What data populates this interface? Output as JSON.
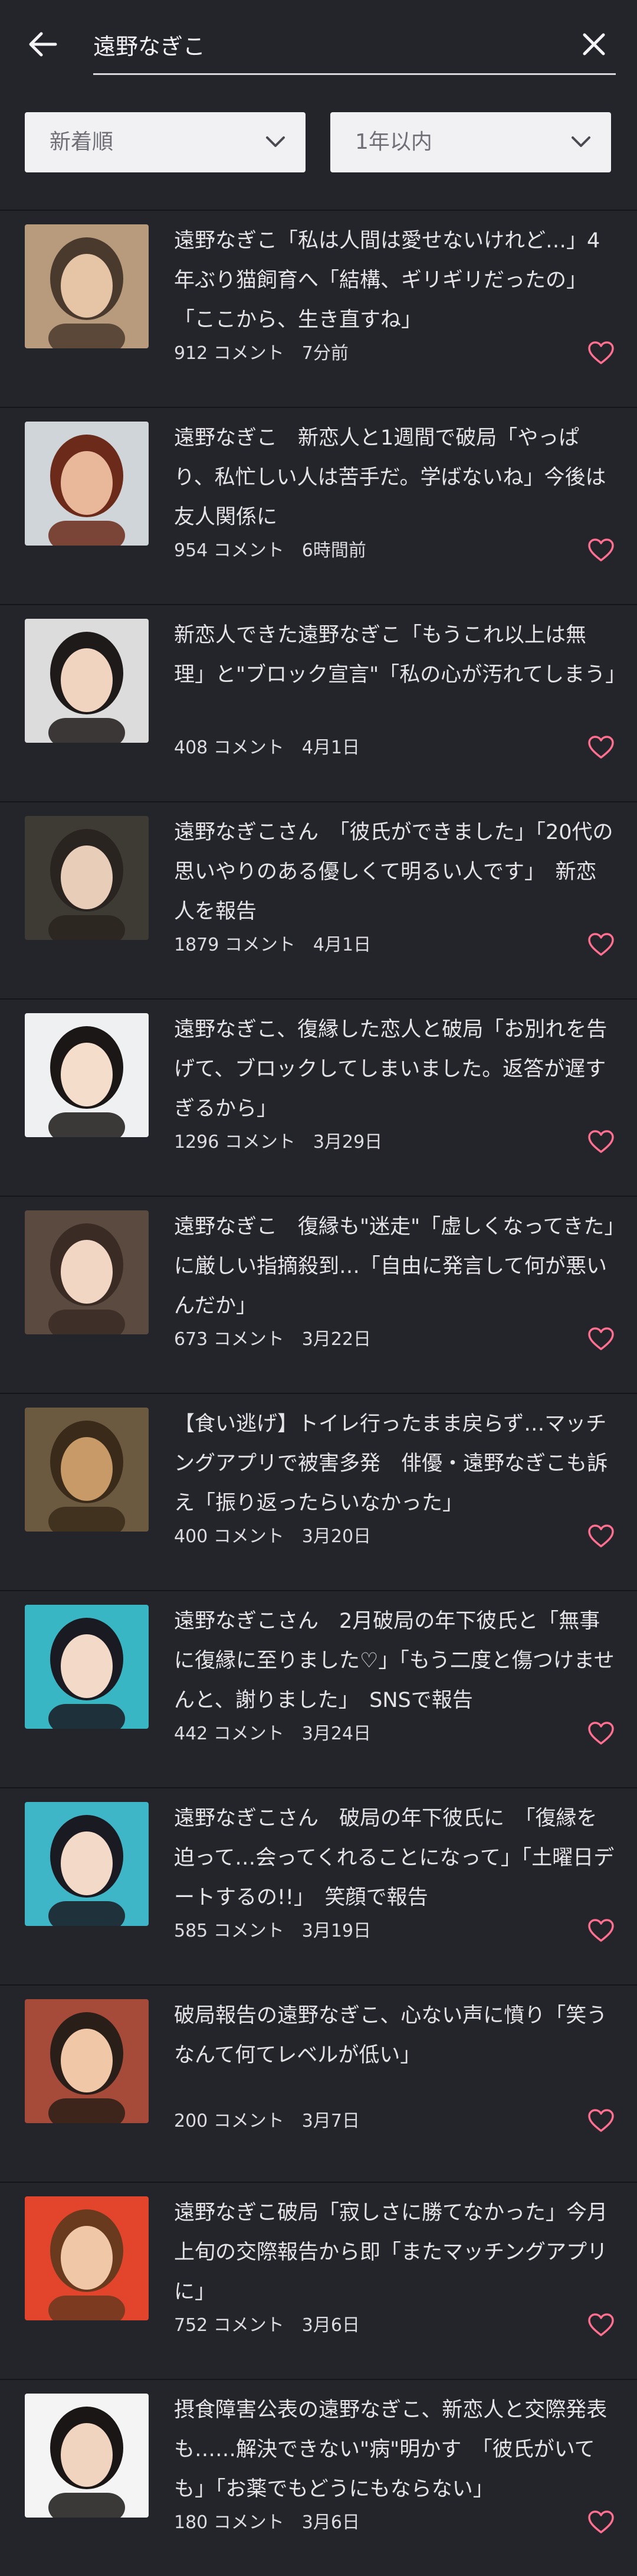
{
  "header": {
    "back_icon": "arrow-left-icon",
    "search_value": "遠野なぎこ",
    "clear_icon": "close-icon"
  },
  "filters": {
    "sort_selected": "新着順",
    "period_selected": "1年以内"
  },
  "colors": {
    "background": "#24242b",
    "heart": "#ff6f8f",
    "select_bg": "#f1f1f4"
  },
  "articles": [
    {
      "title": "遠野なぎこ「私は人間は愛せないけれど…」4年ぶり猫飼育へ「結構、ギリギリだったの」「ここから、生き直すね」",
      "comments": "912 コメント",
      "time": "7分前",
      "lines": 3
    },
    {
      "title": "遠野なぎこ　新恋人と1週間で破局「やっぱり、私忙しい人は苦手だ。学ばないね」今後は友人関係に",
      "comments": "954 コメント",
      "time": "6時間前",
      "lines": 3
    },
    {
      "title": "新恋人できた遠野なぎこ「もうこれ以上は無理」と\"ブロック宣言\"「私の心が汚れてしまう」",
      "comments": "408 コメント",
      "time": "4月1日",
      "lines": 3
    },
    {
      "title": "遠野なぎこさん　「彼氏ができました」「20代の思いやりのある優しくて明るい人です」　新恋人を報告",
      "comments": "1879 コメント",
      "time": "4月1日",
      "lines": 3
    },
    {
      "title": "遠野なぎこ、復縁した恋人と破局「お別れを告げて、ブロックしてしまいました。返答が遅すぎるから」",
      "comments": "1296 コメント",
      "time": "3月29日",
      "lines": 3
    },
    {
      "title": "遠野なぎこ　復縁も\"迷走\"「虚しくなってきた」に厳しい指摘殺到…「自由に発言して何が悪いんだか」",
      "comments": "673 コメント",
      "time": "3月22日",
      "lines": 3
    },
    {
      "title": "【食い逃げ】トイレ行ったまま戻らず…マッチングアプリで被害多発　俳優・遠野なぎこも訴え「振り返ったらいなかった」",
      "comments": "400 コメント",
      "time": "3月20日",
      "lines": 3
    },
    {
      "title": "遠野なぎこさん　2月破局の年下彼氏と「無事に復縁に至りました♡」「もう二度と傷つけませんと、謝りました」　SNSで報告",
      "comments": "442 コメント",
      "time": "3月24日",
      "lines": 3
    },
    {
      "title": "遠野なぎこさん　破局の年下彼氏に　「復縁を迫って…会ってくれることになって」「土曜日デートするの!!」　笑顔で報告",
      "comments": "585 コメント",
      "time": "3月19日",
      "lines": 3
    },
    {
      "title": "破局報告の遠野なぎこ、心ない声に憤り「笑うなんて何てレベルが低い」",
      "comments": "200 コメント",
      "time": "3月7日",
      "lines": 2
    },
    {
      "title": "遠野なぎこ破局「寂しさに勝てなかった」今月上旬の交際報告から即「またマッチングアプリに」",
      "comments": "752 コメント",
      "time": "3月6日",
      "lines": 3
    },
    {
      "title": "摂食障害公表の遠野なぎこ、新恋人と交際発表も……解決できない\"病\"明かす　「彼氏がいても」「お薬でもどうにもならない」",
      "comments": "180 コメント",
      "time": "3月6日",
      "lines": 3
    }
  ]
}
